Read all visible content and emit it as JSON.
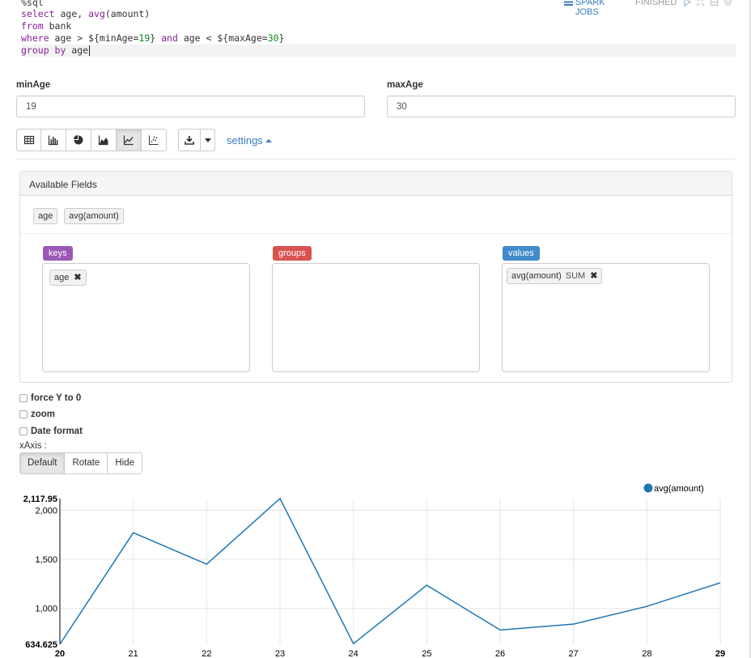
{
  "paragraph": {
    "code_lines": [
      [
        {
          "t": "%sql",
          "c": "fn"
        }
      ],
      [
        {
          "t": "select",
          "c": "kw"
        },
        {
          "t": " age, ",
          "c": "fn"
        },
        {
          "t": "avg",
          "c": "kw"
        },
        {
          "t": "(amount)",
          "c": "fn"
        }
      ],
      [
        {
          "t": "from",
          "c": "kw"
        },
        {
          "t": " bank",
          "c": "fn"
        }
      ],
      [
        {
          "t": "where",
          "c": "kw"
        },
        {
          "t": " age > ${minAge=",
          "c": "fn"
        },
        {
          "t": "19",
          "c": "num"
        },
        {
          "t": "} ",
          "c": "fn"
        },
        {
          "t": "and",
          "c": "kw"
        },
        {
          "t": " age < ${maxAge=",
          "c": "fn"
        },
        {
          "t": "30",
          "c": "num"
        },
        {
          "t": "}",
          "c": "fn"
        }
      ],
      [
        {
          "t": "group by",
          "c": "kw"
        },
        {
          "t": " age",
          "c": "fn"
        }
      ]
    ],
    "status": {
      "jobs_label": "SPARK JOBS",
      "state": "FINISHED"
    }
  },
  "form": {
    "min_label": "minAge",
    "min_value": "19",
    "max_label": "maxAge",
    "max_value": "30"
  },
  "toolbar": {
    "chart_buttons": [
      {
        "name": "table-view-button",
        "icon": "table-icon",
        "active": false
      },
      {
        "name": "bar-chart-button",
        "icon": "bar-chart-icon",
        "active": false
      },
      {
        "name": "pie-chart-button",
        "icon": "pie-chart-icon",
        "active": false
      },
      {
        "name": "area-chart-button",
        "icon": "area-chart-icon",
        "active": false
      },
      {
        "name": "line-chart-button",
        "icon": "line-chart-icon",
        "active": true
      },
      {
        "name": "scatter-chart-button",
        "icon": "scatter-chart-icon",
        "active": false
      }
    ],
    "settings_label": "settings"
  },
  "settings_panel": {
    "title": "Available Fields",
    "fields": [
      "age",
      "avg(amount)"
    ],
    "keys_label": "keys",
    "groups_label": "groups",
    "values_label": "values",
    "keys_items": [
      {
        "label": "age"
      }
    ],
    "values_items": [
      {
        "label": "avg(amount)",
        "agg": "SUM"
      }
    ],
    "colors": {
      "keys": "#9b59b6",
      "groups": "#d9534f",
      "values": "#428bca"
    }
  },
  "options": {
    "force_y": "force Y to 0",
    "zoom": "zoom",
    "date_format": "Date format",
    "xaxis_label": "xAxis :",
    "xaxis_buttons": [
      {
        "label": "Default",
        "active": true
      },
      {
        "label": "Rotate",
        "active": false
      },
      {
        "label": "Hide",
        "active": false
      }
    ]
  },
  "chart_data": {
    "type": "line",
    "x": [
      20,
      21,
      22,
      23,
      24,
      25,
      26,
      27,
      28,
      29
    ],
    "series": [
      {
        "name": "avg(amount)",
        "color": "#1f77b4",
        "values": [
          634.625,
          1770,
          1450,
          2117.95,
          640,
          1235,
          780,
          840,
          1020,
          1260
        ]
      }
    ],
    "xtick_labels": [
      "20",
      "21",
      "22",
      "23",
      "24",
      "25",
      "26",
      "27",
      "28",
      "29"
    ],
    "bold_xticks": [
      "20",
      "29"
    ],
    "ytick_labels": [
      "2,000",
      "1,500",
      "1,000"
    ],
    "ytick_values": [
      2000,
      1500,
      1000
    ],
    "y_max_label": "2,117.95",
    "y_min_label": "634.625",
    "ylim": [
      634.625,
      2117.95
    ],
    "grid": true,
    "legend": "top-right"
  }
}
